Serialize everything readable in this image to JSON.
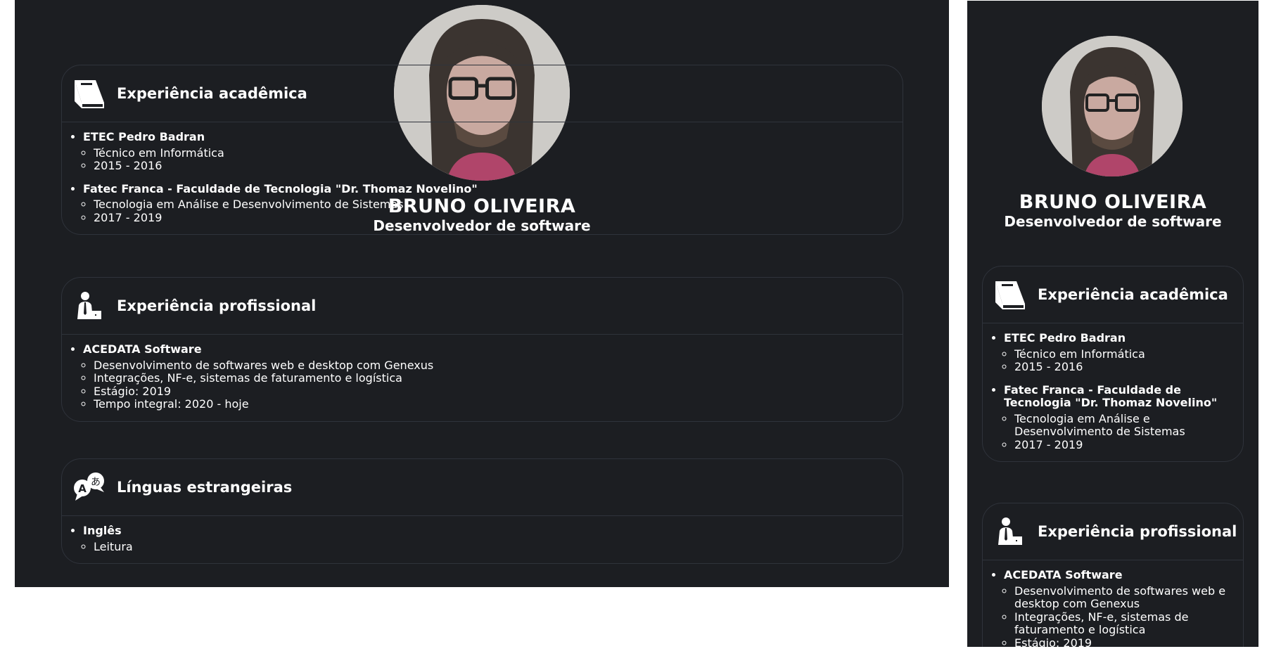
{
  "profile": {
    "name": "BRUNO OLIVEIRA",
    "title": "Desenvolvedor de software"
  },
  "sections": [
    {
      "icon": "book-icon",
      "title": "Experiência acadêmica",
      "items": [
        {
          "heading": "ETEC Pedro Badran",
          "details": [
            "Técnico em Informática",
            "2015 - 2016"
          ]
        },
        {
          "heading": "Fatec Franca - Faculdade de Tecnologia \"Dr. Thomaz Novelino\"",
          "details": [
            "Tecnologia em Análise e Desenvolvimento de Sistemas",
            "2017 - 2019"
          ]
        }
      ]
    },
    {
      "icon": "businessman-laptop-icon",
      "title": "Experiência profissional",
      "items": [
        {
          "heading": "ACEDATA Software",
          "details": [
            "Desenvolvimento de softwares web e desktop com Genexus",
            "Integrações, NF-e, sistemas de faturamento e logística",
            "Estágio: 2019",
            "Tempo integral: 2020 - hoje"
          ]
        }
      ]
    },
    {
      "icon": "translate-icon",
      "title": "Línguas estrangeiras",
      "items": [
        {
          "heading": "Inglês",
          "details": [
            "Leitura"
          ]
        }
      ]
    }
  ],
  "colors": {
    "background": "#1c1e22",
    "border": "#2f333b",
    "text": "#ffffff"
  }
}
